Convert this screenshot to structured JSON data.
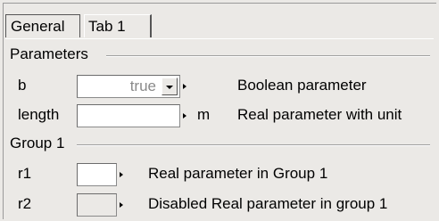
{
  "tabs": [
    {
      "label": "General",
      "active": true
    },
    {
      "label": "Tab 1",
      "active": false
    }
  ],
  "groups": [
    {
      "title": "Parameters",
      "rows": [
        {
          "name": "b",
          "value": "true",
          "unit": "",
          "description": "Boolean parameter",
          "type": "dropdown"
        },
        {
          "name": "length",
          "value": "",
          "unit": "m",
          "description": "Real parameter with unit",
          "type": "input"
        }
      ]
    },
    {
      "title": "Group 1",
      "rows": [
        {
          "name": "r1",
          "value": "",
          "unit": "",
          "description": "Real parameter in Group 1",
          "type": "input"
        },
        {
          "name": "r2",
          "value": "",
          "unit": "",
          "description": "Disabled Real parameter in group 1",
          "type": "input-disabled"
        }
      ]
    }
  ],
  "colors": {
    "background": "#ebe9e6",
    "value_text": "#8a8a8a"
  }
}
